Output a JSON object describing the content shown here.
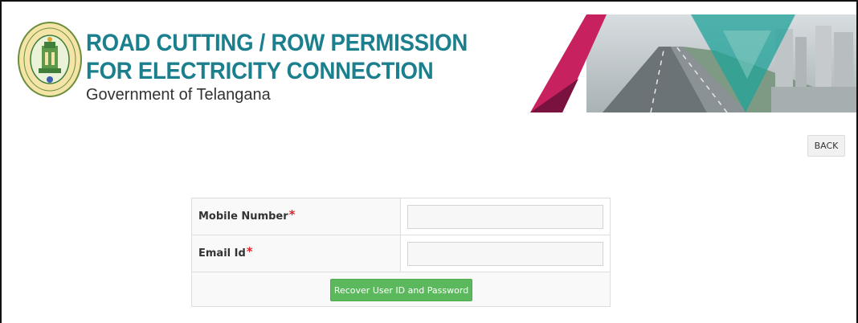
{
  "header": {
    "title_line1": "ROAD CUTTING / ROW PERMISSION",
    "title_line2": "FOR ELECTRICITY CONNECTION",
    "subtitle": "Government of Telangana",
    "logo_icon": "telangana-emblem-icon",
    "banner_icon": "highway-city-banner-image"
  },
  "actions": {
    "back_label": "BACK"
  },
  "form": {
    "mobile_label": "Mobile Number",
    "mobile_value": "",
    "email_label": "Email Id",
    "email_value": "",
    "required_mark": "*",
    "submit_label": "Recover User ID and Password"
  },
  "colors": {
    "title": "#1b7f8e",
    "required": "#e0242e",
    "submit": "#5cb85c",
    "banner_pink": "#c8215f",
    "banner_teal": "#1fa39a"
  }
}
